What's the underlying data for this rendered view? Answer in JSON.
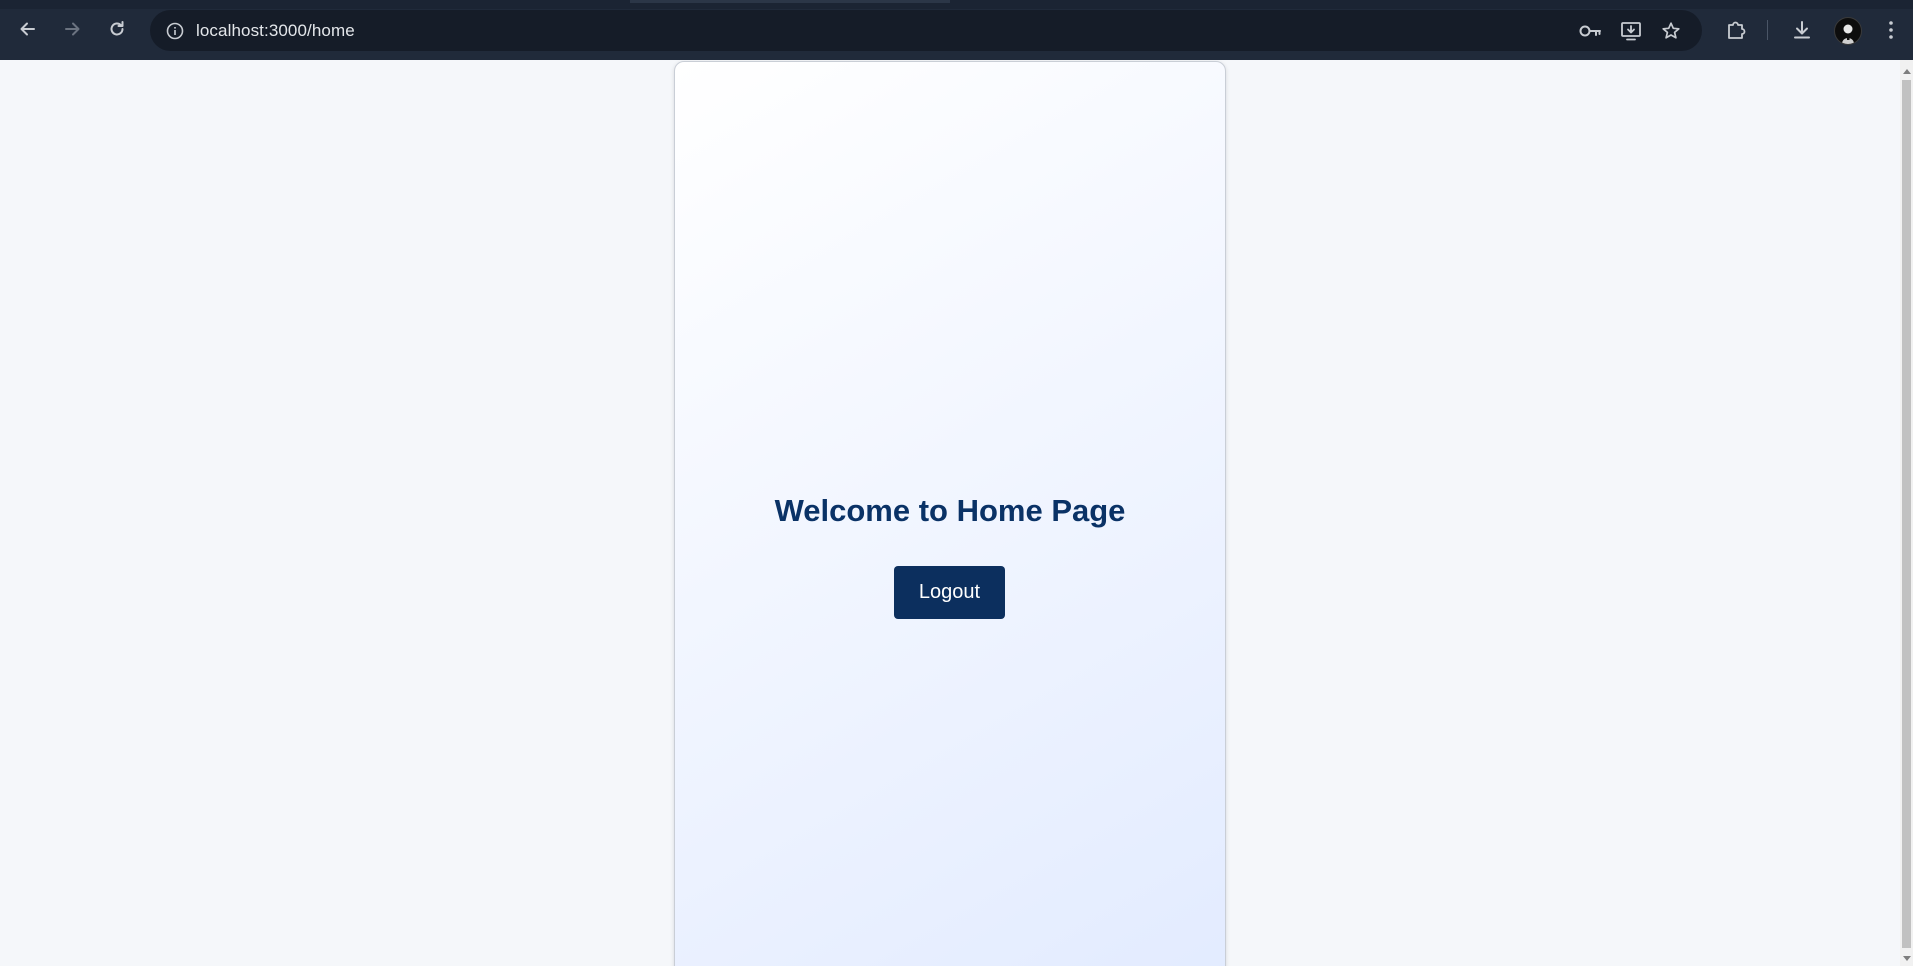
{
  "browser": {
    "url": "localhost:3000/home",
    "icons": {
      "back": "arrow-left-icon",
      "forward": "arrow-right-icon",
      "reload": "reload-icon",
      "site_info": "info-icon",
      "password": "key-icon",
      "install": "install-app-icon",
      "bookmark": "star-icon",
      "extensions": "puzzle-icon",
      "downloads": "download-icon",
      "profile": "avatar",
      "menu": "kebab-menu-icon"
    },
    "colors": {
      "toolbar": "#202a3a",
      "omnibox": "#151c28"
    }
  },
  "page": {
    "heading": "Welcome to Home Page",
    "logout_label": "Logout",
    "colors": {
      "heading": "#0a3266",
      "button": "#0c2f5e",
      "background": "#f5f7fa"
    }
  }
}
